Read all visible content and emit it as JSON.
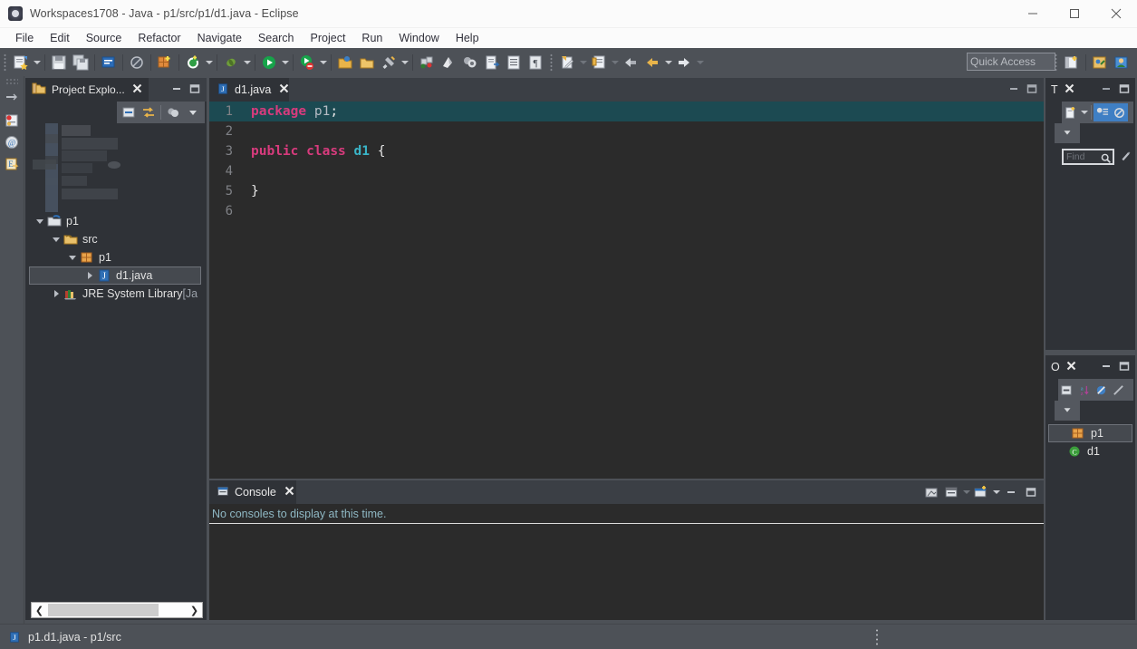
{
  "window": {
    "title": "Workspaces1708 - Java - p1/src/p1/d1.java - Eclipse",
    "app_icon": "eclipse-icon",
    "minimize": "—",
    "maximize": "□",
    "close": "✕"
  },
  "menubar": {
    "items": [
      {
        "label": "File"
      },
      {
        "label": "Edit"
      },
      {
        "label": "Source"
      },
      {
        "label": "Refactor"
      },
      {
        "label": "Navigate"
      },
      {
        "label": "Search"
      },
      {
        "label": "Project"
      },
      {
        "label": "Run"
      },
      {
        "label": "Window"
      },
      {
        "label": "Help"
      }
    ]
  },
  "toolbar": {
    "quick_access_placeholder": "Quick Access",
    "buttons": [
      {
        "name": "new-wizard-icon"
      },
      {
        "name": "save-icon"
      },
      {
        "name": "save-all-icon"
      },
      {
        "name": "new-java-class-icon"
      },
      {
        "name": "skip-breakpoints-icon"
      },
      {
        "name": "new-package-icon"
      },
      {
        "name": "build-all-icon"
      },
      {
        "name": "debug-icon"
      },
      {
        "name": "run-icon"
      },
      {
        "name": "run-external-tools-icon"
      },
      {
        "name": "open-type-icon"
      },
      {
        "name": "open-task-icon"
      },
      {
        "name": "search-icon"
      },
      {
        "name": "new-java-project-icon"
      },
      {
        "name": "new-folder-icon"
      },
      {
        "name": "annotation-icon"
      },
      {
        "name": "next-annotation-icon"
      },
      {
        "name": "previous-annotation-icon"
      },
      {
        "name": "last-edit-location-icon"
      },
      {
        "name": "back-icon"
      },
      {
        "name": "forward-icon"
      }
    ],
    "perspective_buttons": [
      {
        "name": "open-perspective-icon"
      },
      {
        "name": "java-perspective-icon"
      },
      {
        "name": "java-ee-perspective-icon"
      }
    ]
  },
  "shortcut_bar": {
    "items": [
      {
        "name": "restore-icon"
      },
      {
        "name": "problems-view-icon"
      },
      {
        "name": "javadoc-view-icon"
      },
      {
        "name": "declaration-view-icon"
      }
    ]
  },
  "project_explorer": {
    "tab_label": "Project Explo...",
    "tab_icon": "project-explorer-icon",
    "close_icon": "close-icon",
    "minimize_icon": "minimize-icon",
    "maximize_icon": "maximize-icon",
    "toolbar": [
      {
        "name": "collapse-all-icon"
      },
      {
        "name": "link-with-editor-icon"
      },
      {
        "name": "focus-on-active-task-icon"
      },
      {
        "name": "view-menu-icon"
      }
    ],
    "tree": [
      {
        "label": "p1",
        "icon": "java-project-icon",
        "indent": 0,
        "twisty": "down",
        "selected": false
      },
      {
        "label": "src",
        "icon": "source-folder-icon",
        "indent": 1,
        "twisty": "down",
        "selected": false
      },
      {
        "label": "p1",
        "icon": "package-icon",
        "indent": 2,
        "twisty": "down",
        "selected": false
      },
      {
        "label": "d1.java",
        "icon": "java-file-icon",
        "indent": 3,
        "twisty": "right",
        "selected": true
      },
      {
        "label": "JRE System Library",
        "suffix": " [Ja",
        "icon": "jre-library-icon",
        "indent": 1,
        "twisty": "right",
        "selected": false
      }
    ],
    "scrollbar": {
      "left_arrow": "❮",
      "right_arrow": "❯"
    }
  },
  "editor": {
    "tab_label": "d1.java",
    "tab_icon": "java-file-icon",
    "close_icon": "close-icon",
    "minimize_icon": "minimize-icon",
    "maximize_icon": "maximize-icon",
    "lines": [
      {
        "number": "1",
        "highlighted": true,
        "tokens": [
          {
            "text": "package",
            "type": "k"
          },
          {
            "text": " ",
            "type": "w"
          },
          {
            "text": "p1",
            "type": "p"
          },
          {
            "text": ";",
            "type": "w"
          }
        ]
      },
      {
        "number": "2",
        "highlighted": false,
        "tokens": []
      },
      {
        "number": "3",
        "highlighted": false,
        "tokens": [
          {
            "text": "public",
            "type": "k"
          },
          {
            "text": " ",
            "type": "w"
          },
          {
            "text": "class",
            "type": "k"
          },
          {
            "text": " ",
            "type": "w"
          },
          {
            "text": "d1",
            "type": "t"
          },
          {
            "text": " {",
            "type": "w"
          }
        ]
      },
      {
        "number": "4",
        "highlighted": false,
        "tokens": []
      },
      {
        "number": "5",
        "highlighted": false,
        "tokens": [
          {
            "text": "}",
            "type": "w"
          }
        ]
      },
      {
        "number": "6",
        "highlighted": false,
        "tokens": []
      }
    ]
  },
  "console": {
    "tab_label": "Console",
    "tab_icon": "console-icon",
    "close_icon": "close-icon",
    "message": "No consoles to display at this time.",
    "buttons": [
      {
        "name": "clear-console-icon"
      },
      {
        "name": "display-selected-console-icon"
      },
      {
        "name": "display-selected-console-dropdown-icon"
      },
      {
        "name": "open-console-icon"
      },
      {
        "name": "open-console-dropdown-icon"
      },
      {
        "name": "minimize-icon"
      },
      {
        "name": "maximize-icon"
      }
    ]
  },
  "task_list": {
    "tab_label": "T",
    "close_icon": "close-icon",
    "minimize_icon": "minimize-icon",
    "maximize_icon": "maximize-icon",
    "toolbar": [
      {
        "name": "new-task-icon"
      },
      {
        "name": "new-task-dropdown-icon"
      },
      {
        "name": "categorize-icon"
      },
      {
        "name": "focus-on-workweek-icon"
      },
      {
        "name": "view-menu-icon"
      }
    ],
    "find_placeholder": "Find",
    "find_value": "",
    "search_icon": "search-icon",
    "pencil_icon": "pencil-icon"
  },
  "outline": {
    "tab_label": "O",
    "close_icon": "close-icon",
    "minimize_icon": "minimize-icon",
    "maximize_icon": "maximize-icon",
    "toolbar": [
      {
        "name": "collapse-all-icon"
      },
      {
        "name": "sort-icon"
      },
      {
        "name": "hide-fields-icon"
      },
      {
        "name": "hide-static-icon"
      },
      {
        "name": "view-menu-icon"
      }
    ],
    "rows": [
      {
        "label": "p1",
        "icon": "package-icon",
        "selected": true
      },
      {
        "label": "d1",
        "icon": "class-icon",
        "selected": false
      }
    ]
  },
  "statusbar": {
    "icon": "java-file-icon",
    "text": "p1.d1.java - p1/src"
  },
  "colors": {
    "toolbar_bg": "#4d5157",
    "panel_bg": "#2f3237",
    "editor_bg": "#2b2b2b",
    "tabbar_bg": "#3b3f45",
    "keyword": "#d83b7d",
    "type": "#3ab5c8",
    "line_highlight": "#1c4a52",
    "console_text": "#8fb8c4",
    "selection_border": "#6e7279"
  }
}
